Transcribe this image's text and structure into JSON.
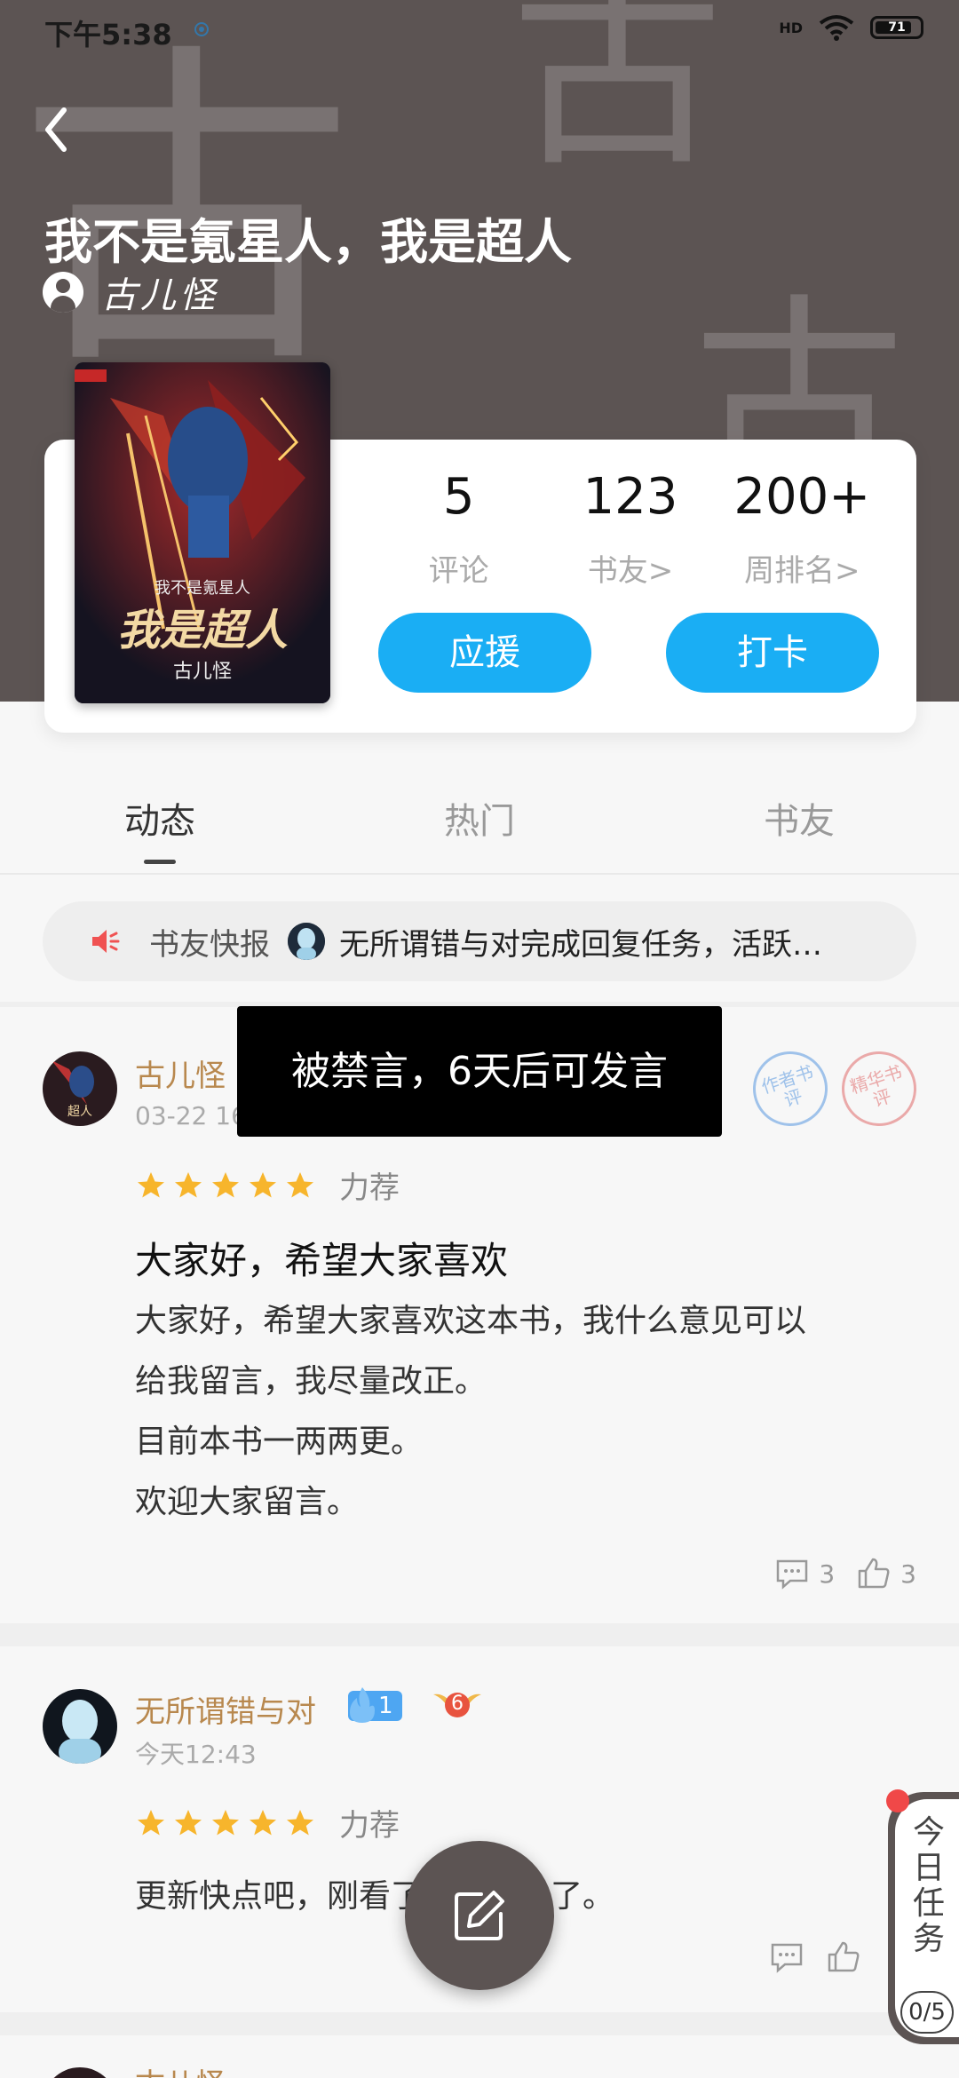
{
  "status_bar": {
    "time": "下午5:38",
    "network": "HD",
    "battery": "71"
  },
  "book": {
    "title": "我不是氪星人，我是超人",
    "author": "古儿怪",
    "watermark_char": "古"
  },
  "cover": {
    "top_line": "我不是氪星人",
    "big_line": "我是超人",
    "author": "古儿怪"
  },
  "stats": [
    {
      "value": "5",
      "label": "评论"
    },
    {
      "value": "123",
      "label": "书友>"
    },
    {
      "value": "200+",
      "label": "周排名>"
    }
  ],
  "buttons": {
    "support": "应援",
    "checkin": "打卡"
  },
  "tabs": [
    "动态",
    "热门",
    "书友"
  ],
  "notice": {
    "label": "书友快报",
    "text": "无所谓错与对完成回复任务，活跃…"
  },
  "toast": "被禁言，6天后可发言",
  "posts": [
    {
      "name": "古儿怪",
      "time": "03-22 16",
      "stamps": [
        "作者书评",
        "精华书评"
      ],
      "rating": 5,
      "rec_label": "力荐",
      "title": "大家好，希望大家喜欢",
      "body": [
        "大家好，希望大家喜欢这本书，我什么意见可以",
        "给我留言，我尽量改正。",
        "目前本书一两两更。",
        "欢迎大家留言。"
      ],
      "comments": "3",
      "likes": "3"
    },
    {
      "name": "无所谓错与对",
      "time": "今天12:43",
      "fire_level": "1",
      "badge_level": "6",
      "rating": 5,
      "rec_label": "力荐",
      "body": [
        "更新快点吧，刚看了一下就没了。"
      ]
    },
    {
      "name": "古儿怪"
    }
  ],
  "daily_task": {
    "label": "今日任务",
    "count": "0/5"
  },
  "colors": {
    "accent": "#1aaef4",
    "header": "#5c5453",
    "author_name": "#b8884e",
    "star": "#f7b52c"
  }
}
